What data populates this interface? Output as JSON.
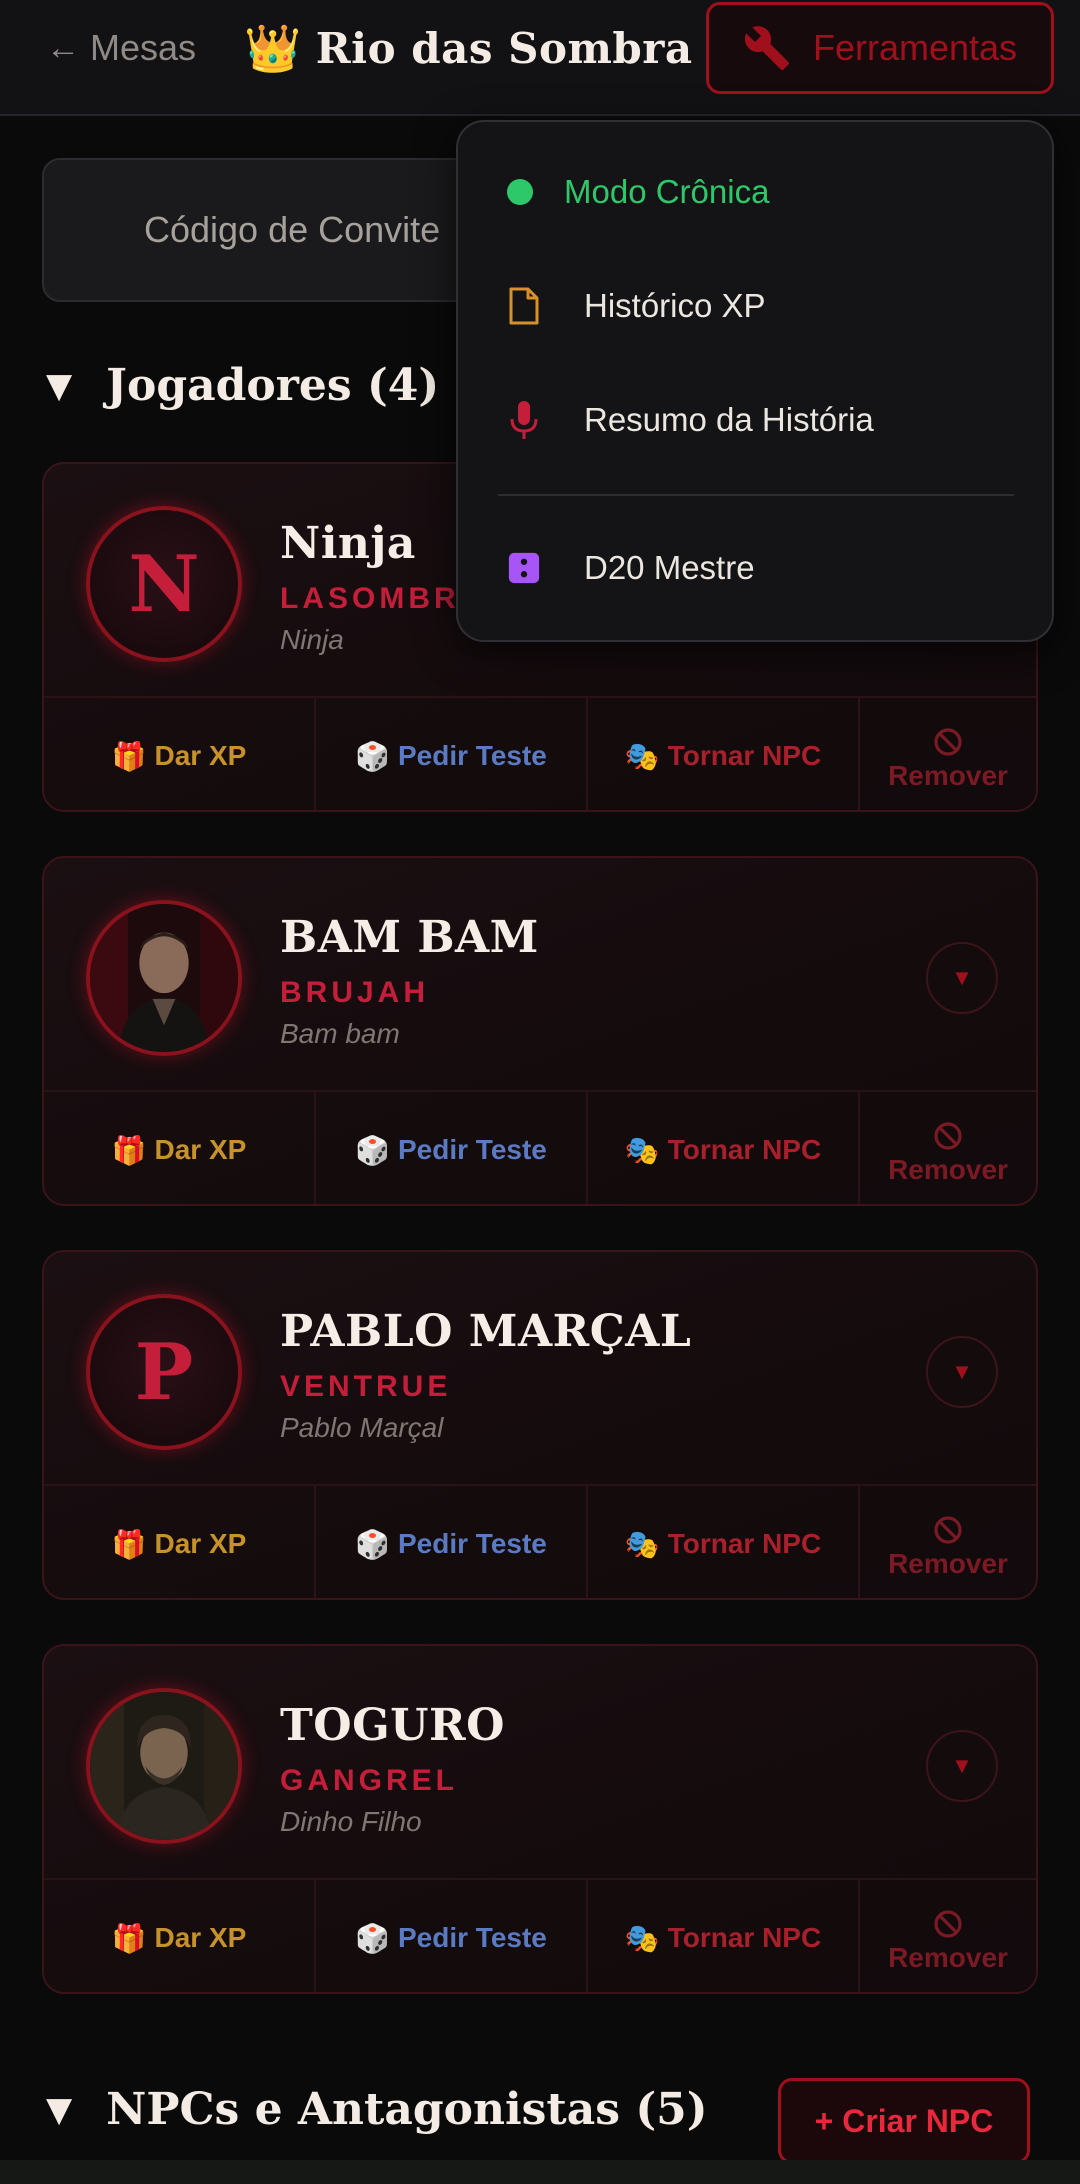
{
  "header": {
    "back_label": "Mesas",
    "back_arrow": "←",
    "title": "Rio das Sombra",
    "crown_emoji": "👑",
    "tools_label": "Ferramentas",
    "tools_icon": "wrench-icon"
  },
  "invite": {
    "label": "Código de Convite"
  },
  "players_section": {
    "toggle": "▼",
    "title": "Jogadores (4)"
  },
  "players": [
    {
      "initial": "N",
      "name": "Ninja",
      "clan": "LASOMBRA",
      "player": "Ninja",
      "avatar": "letter"
    },
    {
      "initial": "",
      "name": "BAM BAM",
      "clan": "BRUJAH",
      "player": "Bam bam",
      "avatar": "photo"
    },
    {
      "initial": "P",
      "name": "PABLO MARÇAL",
      "clan": "VENTRUE",
      "player": "Pablo Marçal",
      "avatar": "letter"
    },
    {
      "initial": "",
      "name": "TOGURO",
      "clan": "GANGREL",
      "player": "Dinho Filho",
      "avatar": "photo"
    }
  ],
  "actions": {
    "xp": {
      "emoji": "🎁",
      "label": "Dar XP"
    },
    "test": {
      "emoji": "🎲",
      "label": "Pedir Teste"
    },
    "npc": {
      "emoji": "🎭",
      "label": "Tornar NPC"
    },
    "remove": {
      "emoji": "⃠",
      "label": "Remover"
    }
  },
  "expand_glyph": "▼",
  "menu": {
    "items": [
      {
        "label": "Modo Crônica",
        "icon": "green-dot-icon",
        "color": "#2ec76a"
      },
      {
        "label": "Histórico XP",
        "icon": "document-icon",
        "color": "#d8902a"
      },
      {
        "label": "Resumo da História",
        "icon": "microphone-icon",
        "color": "#c41e3a"
      },
      {
        "label": "D20 Mestre",
        "icon": "die-icon",
        "color": "#a855f7"
      }
    ]
  },
  "npc_section": {
    "toggle": "▼",
    "title": "NPCs e Antagonistas (5)",
    "create_label": "+ Criar NPC"
  },
  "colors": {
    "accent": "#a0101c",
    "clan": "#c41e3a",
    "xp": "#c8922a",
    "test": "#5a7ac4"
  }
}
